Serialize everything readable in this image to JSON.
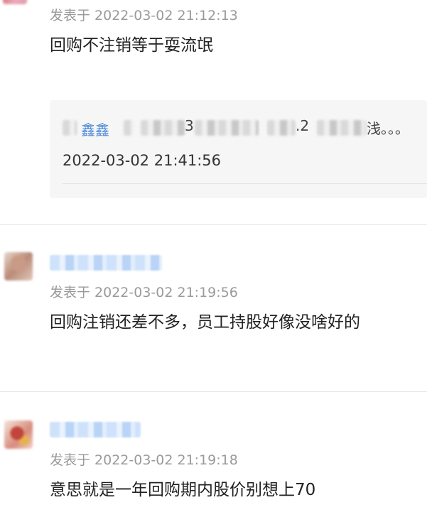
{
  "comments": [
    {
      "time": "发表于 2022-03-02 21:12:13",
      "text": "回购不注销等于耍流氓",
      "reply": {
        "name": "鑫鑫",
        "fragment_a": "3",
        "fragment_b": ".2",
        "fragment_c": "浅。。。",
        "time": "2022-03-02 21:41:56"
      }
    },
    {
      "time": "发表于 2022-03-02 21:19:56",
      "text": "回购注销还差不多，员工持股好像没啥好的"
    },
    {
      "time": "发表于 2022-03-02 21:19:18",
      "text": "意思就是一年回购期内股价别想上70"
    }
  ]
}
